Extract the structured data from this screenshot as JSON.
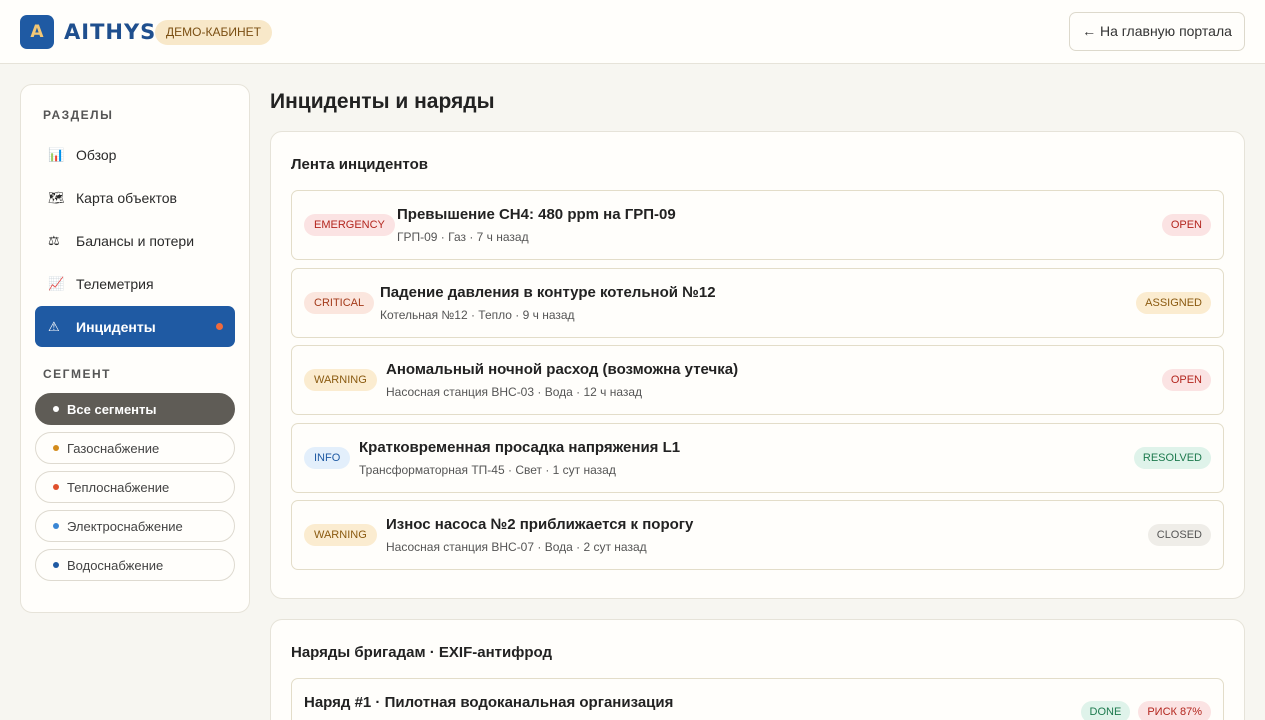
{
  "header": {
    "logo_letter": "A",
    "brand": "AITHYS",
    "demo_badge": "ДЕМО-КАБИНЕТ",
    "home_button": "← На главную портала"
  },
  "sidebar": {
    "sections_label": "РАЗДЕЛЫ",
    "items": [
      {
        "label": "Обзор",
        "icon": "bar-chart-icon",
        "glyph": "📊"
      },
      {
        "label": "Карта объектов",
        "icon": "world-map-icon",
        "glyph": "🗺"
      },
      {
        "label": "Балансы и потери",
        "icon": "scales-icon",
        "glyph": "⚖"
      },
      {
        "label": "Телеметрия",
        "icon": "line-chart-icon",
        "glyph": "📈"
      },
      {
        "label": "Инциденты",
        "icon": "warning-icon",
        "glyph": "⚠",
        "active": true
      }
    ],
    "segment_label": "СЕГМЕНТ",
    "segments": [
      {
        "label": "Все сегменты",
        "color": "#ffffff",
        "active": true
      },
      {
        "label": "Газоснабжение",
        "color": "#d38b1b"
      },
      {
        "label": "Теплоснабжение",
        "color": "#e0502c"
      },
      {
        "label": "Электроснабжение",
        "color": "#3a86d4"
      },
      {
        "label": "Водоснабжение",
        "color": "#1f5aa3"
      }
    ]
  },
  "main": {
    "page_title": "Инциденты и наряды",
    "incidents_card": {
      "title": "Лента инцидентов",
      "items": [
        {
          "severity": "EMERGENCY",
          "title": "Превышение CH4: 480 ppm на ГРП-09",
          "subtitle": "ГРП-09 · Газ · 7 ч назад",
          "status": "OPEN"
        },
        {
          "severity": "CRITICAL",
          "title": "Падение давления в контуре котельной №12",
          "subtitle": "Котельная №12 · Тепло · 9 ч назад",
          "status": "ASSIGNED"
        },
        {
          "severity": "WARNING",
          "title": "Аномальный ночной расход (возможна утечка)",
          "subtitle": "Насосная станция ВНС-03 · Вода · 12 ч назад",
          "status": "OPEN"
        },
        {
          "severity": "INFO",
          "title": "Кратковременная просадка напряжения L1",
          "subtitle": "Трансформаторная ТП-45 · Свет · 1 сут назад",
          "status": "RESOLVED"
        },
        {
          "severity": "WARNING",
          "title": "Износ насоса №2 приближается к порогу",
          "subtitle": "Насосная станция ВНС-07 · Вода · 2 сут назад",
          "status": "CLOSED"
        }
      ]
    },
    "orders_card": {
      "title": "Наряды бригадам · EXIF-антифрод",
      "items": [
        {
          "title": "Наряд #1 · Пилотная водоканальная организация",
          "status": "DONE",
          "risk": "РИСК 87%"
        }
      ]
    }
  },
  "colors": {
    "accent": "#1f5aa3",
    "emergency_bg": "#fbe3e3",
    "emergency_fg": "#b3261e",
    "critical_bg": "#fbe6de",
    "critical_fg": "#a33a1a",
    "warning_bg": "#fbecd0",
    "warning_fg": "#8a5a10",
    "info_bg": "#e3effb",
    "info_fg": "#1f5aa3",
    "resolved_bg": "#dff3ea",
    "resolved_fg": "#1d7a4e",
    "closed_bg": "#efede8",
    "closed_fg": "#555555"
  }
}
